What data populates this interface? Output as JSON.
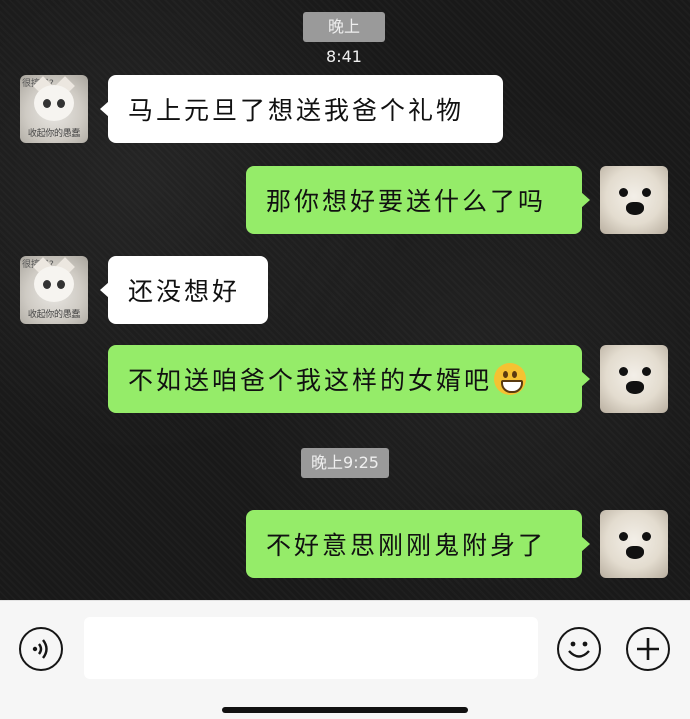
{
  "chat": {
    "timestamps": [
      "晚上8:41",
      "晚上9:25"
    ],
    "contact_avatar_caption_top": "很搞吗?",
    "contact_avatar_caption_bottom": "收起你的愚蠢",
    "messages": [
      {
        "side": "left",
        "text": "马上元旦了想送我爸个礼物"
      },
      {
        "side": "right",
        "text": "那你想好要送什么了吗"
      },
      {
        "side": "left",
        "text": "还没想好"
      },
      {
        "side": "right",
        "text": "不如送咱爸个我这样的女婿吧",
        "emoji": "grinning-face"
      },
      {
        "side": "right",
        "text": "不好意思刚刚鬼附身了"
      }
    ]
  },
  "input_bar": {
    "voice_icon": "voice-icon",
    "emoji_icon": "emoji-icon",
    "more_icon": "plus-icon",
    "input_value": ""
  },
  "colors": {
    "sent_bubble": "#95ec69",
    "received_bubble": "#ffffff",
    "timestamp_bg": "#9a9a9a"
  }
}
